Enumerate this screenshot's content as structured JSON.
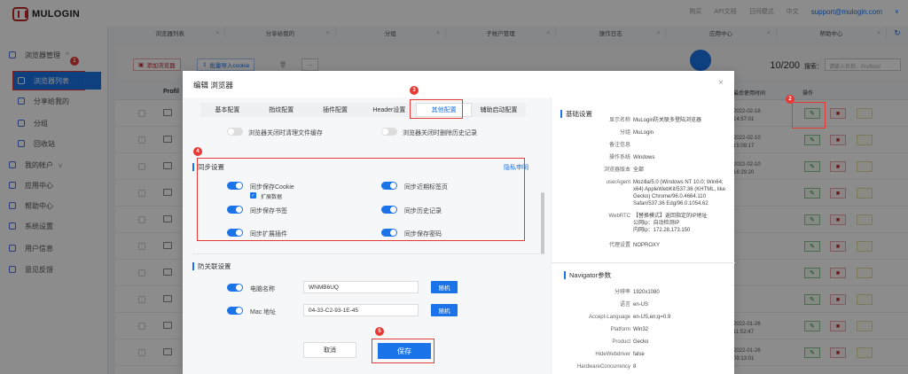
{
  "app": {
    "logo_text": "MULOGIN"
  },
  "topbar": {
    "items": [
      "购买",
      "API文档",
      "日间模式",
      "中文"
    ],
    "email": "support@mulogin.com"
  },
  "sidebar": {
    "items": [
      {
        "label": "浏览器管理",
        "chevron": "^"
      },
      {
        "label": "浏览器列表"
      },
      {
        "label": "分享给我的"
      },
      {
        "label": "分组"
      },
      {
        "label": "回收站"
      },
      {
        "label": "我的帐户",
        "chevron": "v"
      },
      {
        "label": "应用中心"
      },
      {
        "label": "帮助中心"
      },
      {
        "label": "系统设置"
      },
      {
        "label": "用户信息"
      },
      {
        "label": "意见反馈"
      }
    ]
  },
  "content_tabs": [
    "浏览器列表",
    "分享给我的",
    "分组",
    "子帐户管理",
    "操作日志",
    "应用中心",
    "帮助中心"
  ],
  "toolbar": {
    "add_label": "添加浏览器",
    "import_label": "批量导入cookie",
    "more_label": "···",
    "count": "10/200",
    "search_label": "搜索：",
    "search_placeholder": "请输入名称、Profileid"
  },
  "table": {
    "header_profile": "Profil",
    "header_last_used": "最后使用时间",
    "header_actions": "操作",
    "rows": [
      {
        "date": "2022-02-18",
        "time": "14:57:01"
      },
      {
        "date": "2022-02-10",
        "time": "15:09:17"
      },
      {
        "date": "2022-02-10",
        "time": "16:29:20"
      },
      {
        "date": "",
        "time": ""
      },
      {
        "date": "",
        "time": ""
      },
      {
        "date": "",
        "time": ""
      },
      {
        "date": "",
        "time": ""
      },
      {
        "date": "",
        "time": ""
      },
      {
        "date": "2022-01-26",
        "time": "11:52:47"
      },
      {
        "date": "2022-01-26",
        "time": "09:13:01"
      }
    ]
  },
  "dialog": {
    "title": "编辑 浏览器",
    "close": "×",
    "tabs": [
      "基本配置",
      "指纹配置",
      "插件配置",
      "Header设置",
      "其他配置",
      "辅助启动配置"
    ],
    "active_tab": "其他配置",
    "clear_cache_label": "浏览器关闭时清理文件缓存",
    "clear_history_label": "浏览器关闭时删除历史记录",
    "sync_section": "同步设置",
    "privacy_link": "隐私申明",
    "sync": {
      "cookie": "同步保存Cookie",
      "ext_data": "扩展数据",
      "bookmarks": "同步保存书签",
      "extensions": "同步扩展插件",
      "recent_tabs": "同步近期标签页",
      "history": "同步历史记录",
      "passwords": "同步保存密码"
    },
    "anti_assoc_section": "防关联设置",
    "computer_name_label": "电脑名称",
    "computer_name_value": "WNMB6UQ",
    "mac_label": "Mac 地址",
    "mac_value": "04-33-C2-93-1E-45",
    "random_label": "随机",
    "cancel_label": "取消",
    "save_label": "保存"
  },
  "info": {
    "basic_section": "基础设置",
    "basic": [
      {
        "k": "显示名称",
        "v": "MuLogin防关联多登陆浏览器"
      },
      {
        "k": "分组",
        "v": "MuLogin"
      },
      {
        "k": "备注信息",
        "v": ""
      },
      {
        "k": "操作系统",
        "v": "Windows"
      },
      {
        "k": "浏览器版本",
        "v": "全部"
      },
      {
        "k": "userAgent",
        "v": "Mozilla/5.0 (Windows NT 10.0; Win64; x64) AppleWebKit/537.36 (KHTML, like Gecko) Chrome/96.0.4664.110 Safari/537.36 Edg/96.0.1054.62"
      },
      {
        "k": "WebRTC",
        "v": "【替换模式】返回指定的IP地址\n公网ip：自动检测IP\n内网ip：172.28.173.150"
      },
      {
        "k": "代理设置",
        "v": "NOPROXY"
      }
    ],
    "nav_section": "Navigator参数",
    "nav": [
      {
        "k": "分辨率",
        "v": "1920x1080"
      },
      {
        "k": "语言",
        "v": "en-US"
      },
      {
        "k": "Accept-Language",
        "v": "en-US,en;q=0.9"
      },
      {
        "k": "Platform",
        "v": "Win32"
      },
      {
        "k": "Product",
        "v": "Gecko"
      },
      {
        "k": "HideWebdriver",
        "v": "false"
      },
      {
        "k": "HardwareConcurrency",
        "v": "8"
      }
    ]
  },
  "annotations": [
    "1",
    "2",
    "3",
    "4",
    "5"
  ],
  "colors": {
    "accent": "#1a73e8",
    "annotation": "#e53935",
    "brand": "#c0282d"
  }
}
